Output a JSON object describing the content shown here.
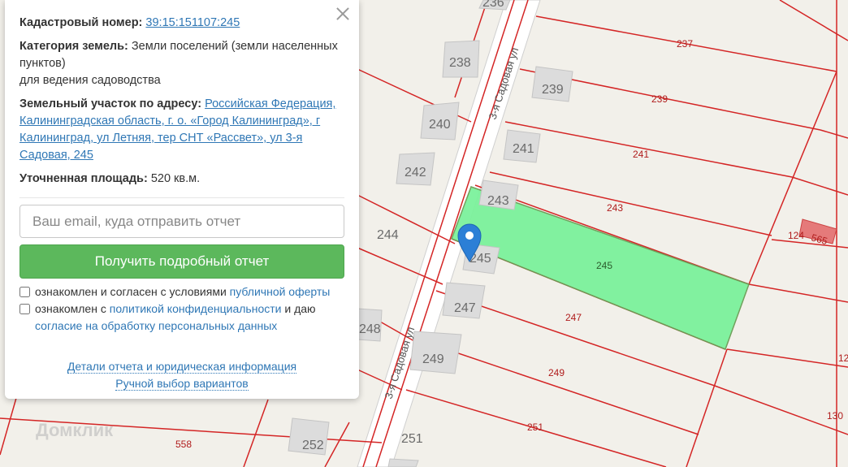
{
  "info": {
    "cadastral_label": "Кадастровый номер:",
    "cadastral_number": "39:15:151107:245",
    "category_label": "Категория земель:",
    "category_value": "Земли поселений (земли населенных пунктов)",
    "usage": "для ведения садоводства",
    "address_label": "Земельный участок по адресу:",
    "address_value": "Российская Федерация, Калининградская область, г. о. «Город Калининград», г Калининград, ул Летняя, тер СНТ «Рассвет», ул 3-я Садовая, 245",
    "area_label": "Уточненная площадь:",
    "area_value": "520 кв.м."
  },
  "form": {
    "email_placeholder": "Ваш email, куда отправить отчет",
    "email_value": "",
    "submit_label": "Получить подробный отчет",
    "consent1_text": "ознакомлен и согласен с условиями ",
    "consent1_link": "публичной оферты",
    "consent2_text_a": "ознакомлен с ",
    "consent2_link_a": "политикой конфиденциальности",
    "consent2_text_b": " и даю ",
    "consent2_link_b": "согласие на обработку персональных данных"
  },
  "links": {
    "details": "Детали отчета и юридическая информация",
    "manual": "Ручной выбор вариантов"
  },
  "map": {
    "streets": [
      "3-я Садовая ул",
      "3-я Садовая ул"
    ],
    "houses": [
      "236",
      "238",
      "239",
      "240",
      "241",
      "242",
      "243",
      "244",
      "245",
      "247",
      "248",
      "249",
      "251",
      "252"
    ],
    "parcels": [
      "237",
      "239",
      "241",
      "243",
      "245",
      "247",
      "249",
      "251",
      "558",
      "124",
      "565",
      "12",
      "130"
    ],
    "selected_parcel": "245",
    "watermark": "Домклик",
    "colors": {
      "parcel_border": "#d42525",
      "selected_fill": "#7cf29c",
      "marker": "#2c7fd6"
    }
  }
}
